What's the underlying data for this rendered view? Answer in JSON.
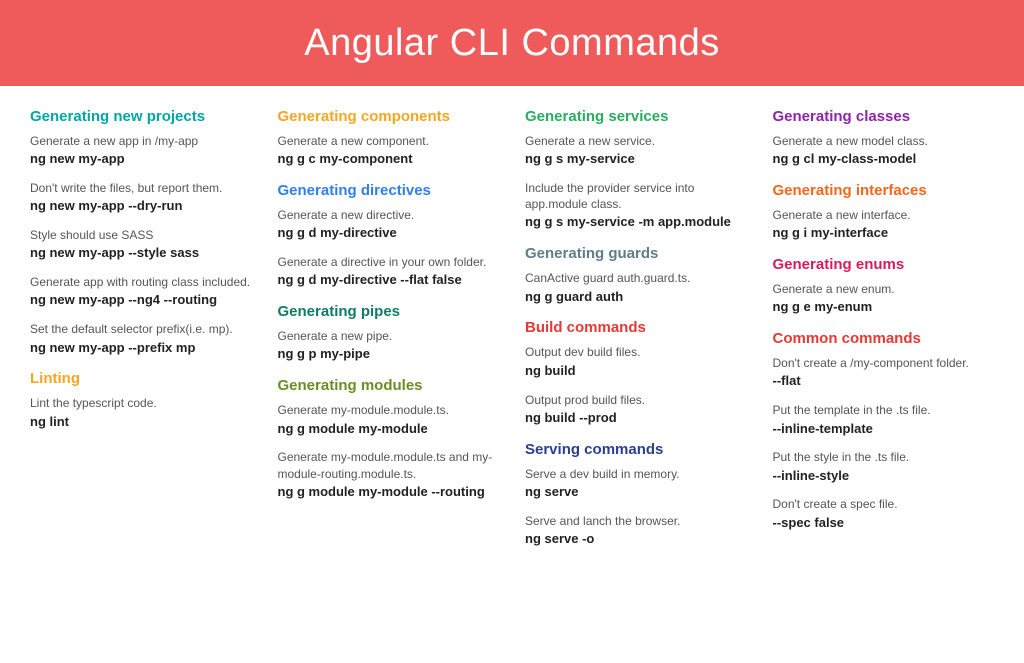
{
  "title": "Angular CLI Commands",
  "columns": [
    [
      {
        "title": "Generating new projects",
        "color": "c-teal",
        "items": [
          {
            "desc": "Generate a new app in /my-app",
            "cmd": "ng new my-app"
          },
          {
            "desc": "Don't write the files, but report them.",
            "cmd": "ng new my-app --dry-run"
          },
          {
            "desc": "Style should use SASS",
            "cmd": "ng new my-app --style sass"
          },
          {
            "desc": "Generate app with routing class included.",
            "cmd": "ng new my-app --ng4 --routing"
          },
          {
            "desc": "Set the default selector prefix(i.e. mp).",
            "cmd": "ng new my-app --prefix mp"
          }
        ]
      },
      {
        "title": "Linting",
        "color": "c-orange",
        "items": [
          {
            "desc": "Lint the typescript code.",
            "cmd": "ng lint"
          }
        ]
      }
    ],
    [
      {
        "title": "Generating components",
        "color": "c-orange",
        "items": [
          {
            "desc": "Generate a new component.",
            "cmd": "ng g c my-component"
          }
        ]
      },
      {
        "title": "Generating directives",
        "color": "c-blue",
        "items": [
          {
            "desc": "Generate a new directive.",
            "cmd": "ng g d my-directive"
          },
          {
            "desc": "Generate a directive in your own folder.",
            "cmd": "ng g d my-directive --flat false"
          }
        ]
      },
      {
        "title": "Generating pipes",
        "color": "c-dteal",
        "items": [
          {
            "desc": "Generate a new pipe.",
            "cmd": "ng g p my-pipe"
          }
        ]
      },
      {
        "title": "Generating modules",
        "color": "c-olive",
        "items": [
          {
            "desc": "Generate my-module.module.ts.",
            "cmd": "ng g module my-module"
          },
          {
            "desc": "Generate my-module.module.ts and my-module-routing.module.ts.",
            "cmd": "ng g module my-module --routing"
          }
        ]
      }
    ],
    [
      {
        "title": "Generating services",
        "color": "c-green",
        "items": [
          {
            "desc": "Generate a new service.",
            "cmd": "ng g s my-service"
          },
          {
            "desc": "Include the provider service into app.module class.",
            "cmd": "ng g s my-service -m app.module"
          }
        ]
      },
      {
        "title": "Generating guards",
        "color": "c-slate",
        "items": [
          {
            "desc": "CanActive guard auth.guard.ts.",
            "cmd": "ng g guard auth"
          }
        ]
      },
      {
        "title": "Build commands",
        "color": "c-red",
        "items": [
          {
            "desc": "Output dev build files.",
            "cmd": "ng build"
          },
          {
            "desc": "Output prod build files.",
            "cmd": "ng build --prod"
          }
        ]
      },
      {
        "title": "Serving commands",
        "color": "c-navy",
        "items": [
          {
            "desc": "Serve a dev build in memory.",
            "cmd": "ng serve"
          },
          {
            "desc": "Serve and lanch the browser.",
            "cmd": "ng serve -o"
          }
        ]
      }
    ],
    [
      {
        "title": "Generating classes",
        "color": "c-purple",
        "items": [
          {
            "desc": "Generate a new model class.",
            "cmd": "ng g cl my-class-model"
          }
        ]
      },
      {
        "title": "Generating interfaces",
        "color": "c-dorange",
        "items": [
          {
            "desc": "Generate a new interface.",
            "cmd": "ng g i my-interface"
          }
        ]
      },
      {
        "title": "Generating enums",
        "color": "c-pink",
        "items": [
          {
            "desc": "Generate a new enum.",
            "cmd": "ng g e my-enum"
          }
        ]
      },
      {
        "title": "Common commands",
        "color": "c-crimson",
        "items": [
          {
            "desc": "Don't create a /my-component folder.",
            "cmd": "--flat"
          },
          {
            "desc": "Put the template in the .ts file.",
            "cmd": "--inline-template"
          },
          {
            "desc": "Put the style in the .ts file.",
            "cmd": "--inline-style"
          },
          {
            "desc": "Don't create a spec file.",
            "cmd": "--spec false"
          }
        ]
      }
    ]
  ]
}
